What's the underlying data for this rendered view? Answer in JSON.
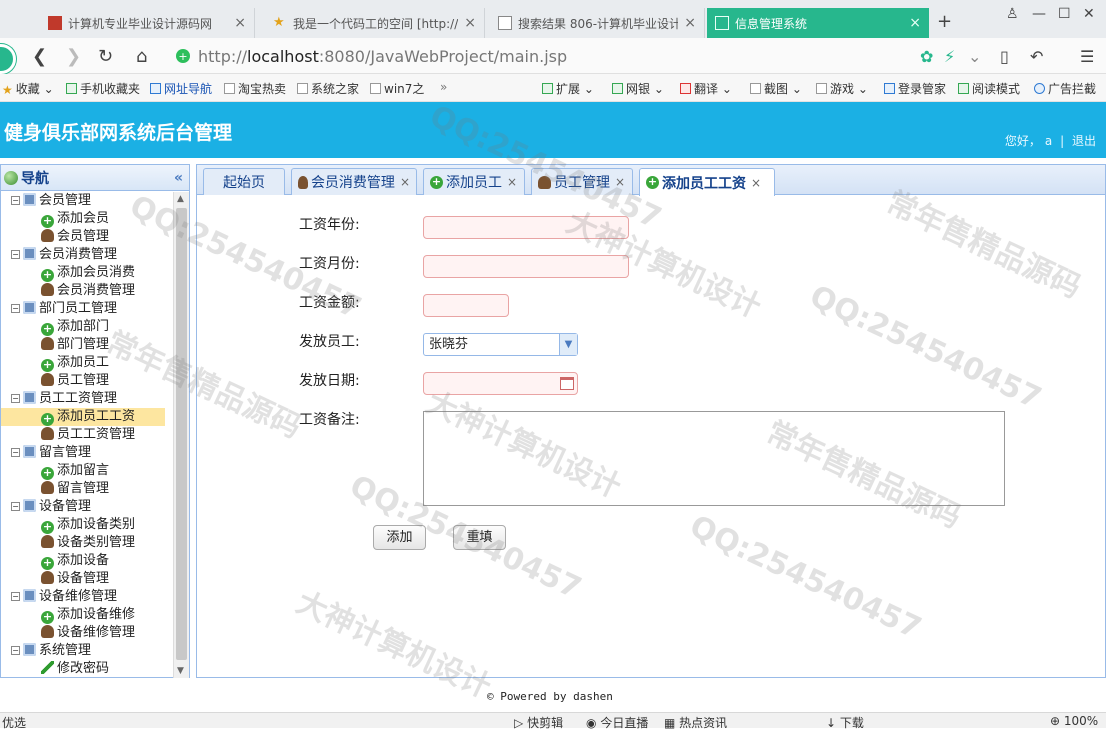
{
  "browser": {
    "tabs": [
      {
        "title": "计算机专业毕业设计源码网",
        "active": false
      },
      {
        "title": "我是一个代码工的空间 [http://",
        "active": false
      },
      {
        "title": "搜索结果 806-计算机毕业设计",
        "active": false
      },
      {
        "title": "信息管理系统",
        "active": true
      }
    ],
    "url_prefix": "http://",
    "url_host": "localhost",
    "url_rest": ":8080/JavaWebProject/main.jsp",
    "bookmarks_left": [
      "收藏",
      "手机收藏夹",
      "网址导航",
      "淘宝热卖",
      "系统之家",
      "win7之"
    ],
    "bookmarks_right": [
      "扩展",
      "网银",
      "翻译",
      "截图",
      "游戏",
      "登录管家",
      "阅读模式",
      "广告拦截"
    ]
  },
  "app": {
    "title": "健身俱乐部网系统后台管理",
    "greeting": "您好，",
    "username": "a",
    "separator": "|",
    "logout": "退出"
  },
  "sidebar": {
    "title": "导航",
    "collapse_glyph": "«",
    "groups": [
      {
        "label": "会员管理",
        "items": [
          {
            "label": "添加会员",
            "icon": "plus"
          },
          {
            "label": "会员管理",
            "icon": "user"
          }
        ]
      },
      {
        "label": "会员消费管理",
        "items": [
          {
            "label": "添加会员消费",
            "icon": "plus"
          },
          {
            "label": "会员消费管理",
            "icon": "user"
          }
        ]
      },
      {
        "label": "部门员工管理",
        "items": [
          {
            "label": "添加部门",
            "icon": "plus"
          },
          {
            "label": "部门管理",
            "icon": "user"
          },
          {
            "label": "添加员工",
            "icon": "plus"
          },
          {
            "label": "员工管理",
            "icon": "user"
          }
        ]
      },
      {
        "label": "员工工资管理",
        "items": [
          {
            "label": "添加员工工资",
            "icon": "plus",
            "selected": true
          },
          {
            "label": "员工工资管理",
            "icon": "user"
          }
        ]
      },
      {
        "label": "留言管理",
        "items": [
          {
            "label": "添加留言",
            "icon": "plus"
          },
          {
            "label": "留言管理",
            "icon": "user"
          }
        ]
      },
      {
        "label": "设备管理",
        "items": [
          {
            "label": "添加设备类别",
            "icon": "plus"
          },
          {
            "label": "设备类别管理",
            "icon": "user"
          },
          {
            "label": "添加设备",
            "icon": "plus"
          },
          {
            "label": "设备管理",
            "icon": "user"
          }
        ]
      },
      {
        "label": "设备维修管理",
        "items": [
          {
            "label": "添加设备维修",
            "icon": "plus"
          },
          {
            "label": "设备维修管理",
            "icon": "user"
          }
        ]
      },
      {
        "label": "系统管理",
        "items": [
          {
            "label": "修改密码",
            "icon": "pen"
          }
        ]
      }
    ]
  },
  "tabs": [
    {
      "label": "起始页",
      "icon": "none",
      "closable": false,
      "active": false
    },
    {
      "label": "会员消费管理",
      "icon": "user",
      "closable": true,
      "active": false
    },
    {
      "label": "添加员工",
      "icon": "plus",
      "closable": true,
      "active": false
    },
    {
      "label": "员工管理",
      "icon": "user",
      "closable": true,
      "active": false
    },
    {
      "label": "添加员工工资",
      "icon": "plus",
      "closable": true,
      "active": true
    }
  ],
  "form": {
    "year_label": "工资年份:",
    "year_value": "",
    "month_label": "工资月份:",
    "month_value": "",
    "amount_label": "工资金额:",
    "amount_value": "",
    "employee_label": "发放员工:",
    "employee_value": "张晓芬",
    "date_label": "发放日期:",
    "date_value": "",
    "remark_label": "工资备注:",
    "remark_value": "",
    "submit_label": "添加",
    "reset_label": "重填"
  },
  "footer": {
    "powered": "© Powered by dashen"
  },
  "statusbar": {
    "left": "优选",
    "items": [
      "快剪辑",
      "今日直播",
      "热点资讯",
      "下载",
      "100%"
    ]
  },
  "watermarks": [
    "QQ:254540457",
    "大神计算机设计",
    "常年售精品源码"
  ]
}
